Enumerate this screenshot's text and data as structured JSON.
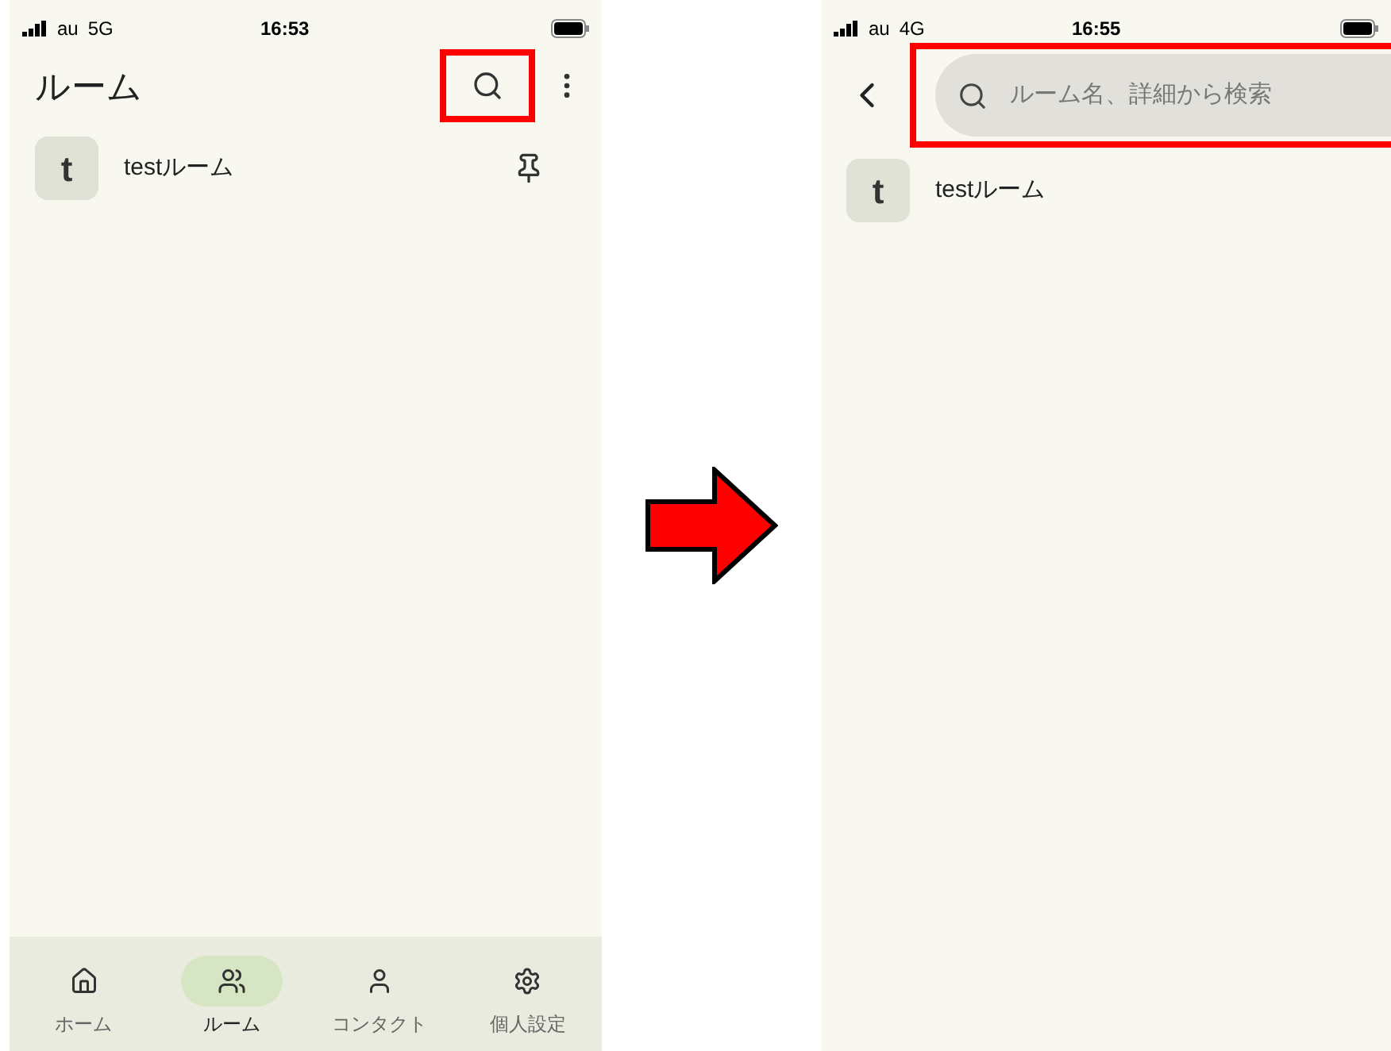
{
  "screens": [
    {
      "kind": "list",
      "status_bar": {
        "carrier": "au",
        "network": "5G",
        "time": "16:53"
      },
      "header": {
        "title": "ルーム",
        "search_highlighted": true
      },
      "rooms": [
        {
          "avatar": "t",
          "name": "testルーム",
          "pinned": true
        }
      ],
      "bottom_nav": [
        {
          "kind": "home",
          "label": "ホーム",
          "selected": false
        },
        {
          "kind": "rooms",
          "label": "ルーム",
          "selected": true
        },
        {
          "kind": "contact",
          "label": "コンタクト",
          "selected": false
        },
        {
          "kind": "settings",
          "label": "個人設定",
          "selected": false
        }
      ]
    },
    {
      "kind": "search",
      "status_bar": {
        "carrier": "au",
        "network": "4G",
        "time": "16:55"
      },
      "search": {
        "placeholder": "ルーム名、詳細から検索",
        "highlighted": true
      },
      "rooms": [
        {
          "avatar": "t",
          "name": "testルーム",
          "pinned": false
        }
      ]
    }
  ]
}
